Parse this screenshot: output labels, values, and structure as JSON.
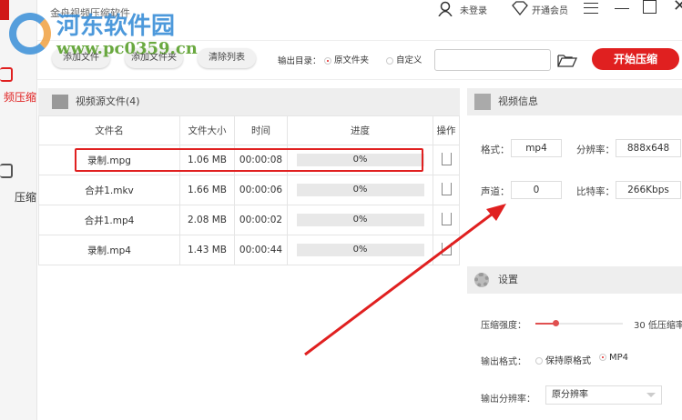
{
  "app": {
    "title": "金舟视频压缩软件",
    "login": "未登录",
    "vip": "开通会员"
  },
  "sidebar": [
    {
      "label": "频压缩",
      "active": true
    },
    {
      "label": "压缩",
      "active": false
    }
  ],
  "toolbar": {
    "add_file": "添加文件",
    "add_folder": "添加文件夹",
    "clear_list": "清除列表",
    "output_dir_label": "输出目录：",
    "opt_source": "原文件夹",
    "opt_custom": "自定义",
    "path_value": "",
    "start": "开始压缩"
  },
  "files": {
    "title": "视频源文件(4)",
    "headers": [
      "文件名",
      "文件大小",
      "时间",
      "进度",
      "操作"
    ],
    "rows": [
      {
        "name": "录制.mpg",
        "size": "1.06 MB",
        "time": "00:00:08",
        "progress": "0%"
      },
      {
        "name": "合并1.mkv",
        "size": "1.66 MB",
        "time": "00:00:06",
        "progress": "0%"
      },
      {
        "name": "合并1.mp4",
        "size": "2.08 MB",
        "time": "00:00:02",
        "progress": "0%"
      },
      {
        "name": "录制.mp4",
        "size": "1.43 MB",
        "time": "00:00:44",
        "progress": "0%"
      }
    ]
  },
  "info": {
    "title": "视频信息",
    "format_label": "格式：",
    "format": "mp4",
    "res_label": "分辨率：",
    "res": "888x648",
    "channel_label": "声道：",
    "channel": "0",
    "bitrate_label": "比特率：",
    "bitrate": "266Kbps"
  },
  "settings": {
    "title": "设置",
    "strength_label": "压缩强度：",
    "strength_value": "30",
    "strength_text": "低压缩率",
    "format_label": "输出格式：",
    "opt_keep": "保持原格式",
    "opt_mp4": "MP4",
    "res_label": "输出分辨率：",
    "res_value": "原分辨率"
  },
  "watermark": {
    "name": "河东软件园",
    "url": "www.pc0359.cn"
  },
  "colors": {
    "accent": "#e02020"
  }
}
